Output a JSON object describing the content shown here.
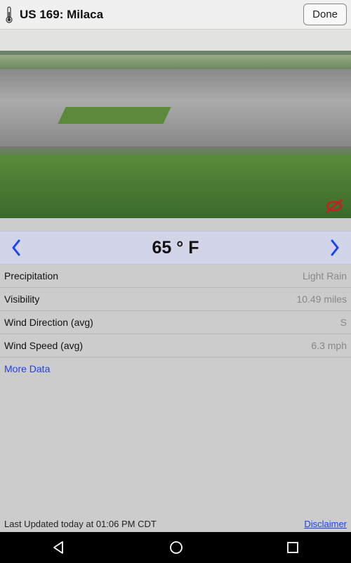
{
  "header": {
    "title": "US 169: Milaca",
    "done_label": "Done"
  },
  "temperature": {
    "display": "65 ° F"
  },
  "rows": [
    {
      "label": "Precipitation",
      "value": "Light Rain"
    },
    {
      "label": "Visibility",
      "value": "10.49  miles"
    },
    {
      "label": "Wind Direction (avg)",
      "value": "S"
    },
    {
      "label": "Wind Speed (avg)",
      "value": "6.3  mph"
    }
  ],
  "more_data_label": "More Data",
  "footer": {
    "updated": "Last Updated today at 01:06 PM CDT",
    "disclaimer": "Disclaimer"
  }
}
